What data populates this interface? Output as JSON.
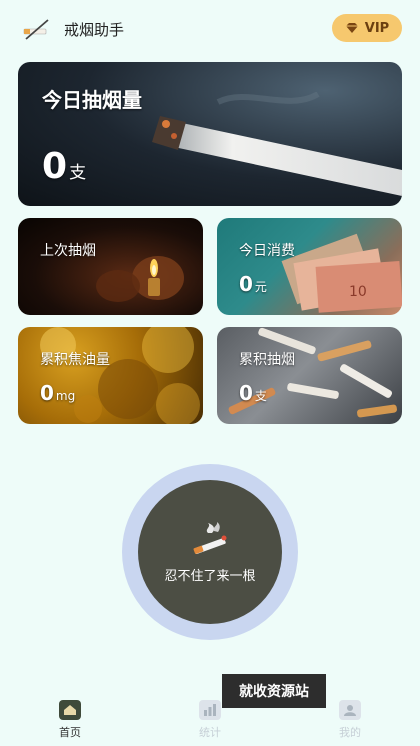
{
  "header": {
    "title": "戒烟助手",
    "vip_label": "VIP"
  },
  "cards": {
    "today_smoked": {
      "label": "今日抽烟量",
      "value": "0",
      "unit": "支"
    },
    "last_smoked": {
      "label": "上次抽烟"
    },
    "today_spend": {
      "label": "今日消费",
      "value": "0",
      "unit": "元"
    },
    "total_tar": {
      "label": "累积焦油量",
      "value": "0",
      "unit": "mg"
    },
    "total_smoked": {
      "label": "累积抽烟",
      "value": "0",
      "unit": "支"
    }
  },
  "smoke_button": {
    "label": "忍不住了来一根"
  },
  "watermark": {
    "text": "就收资源站"
  },
  "tabs": [
    {
      "label": "首页",
      "icon": "home-icon",
      "active": true
    },
    {
      "label": "统计",
      "icon": "stats-icon",
      "active": false
    },
    {
      "label": "我的",
      "icon": "user-icon",
      "active": false
    }
  ],
  "colors": {
    "background": "#eefcf9",
    "vip": "#f6c86e",
    "smoke_button": "#4c4e44",
    "smoke_ring": "#c9d6f0"
  }
}
